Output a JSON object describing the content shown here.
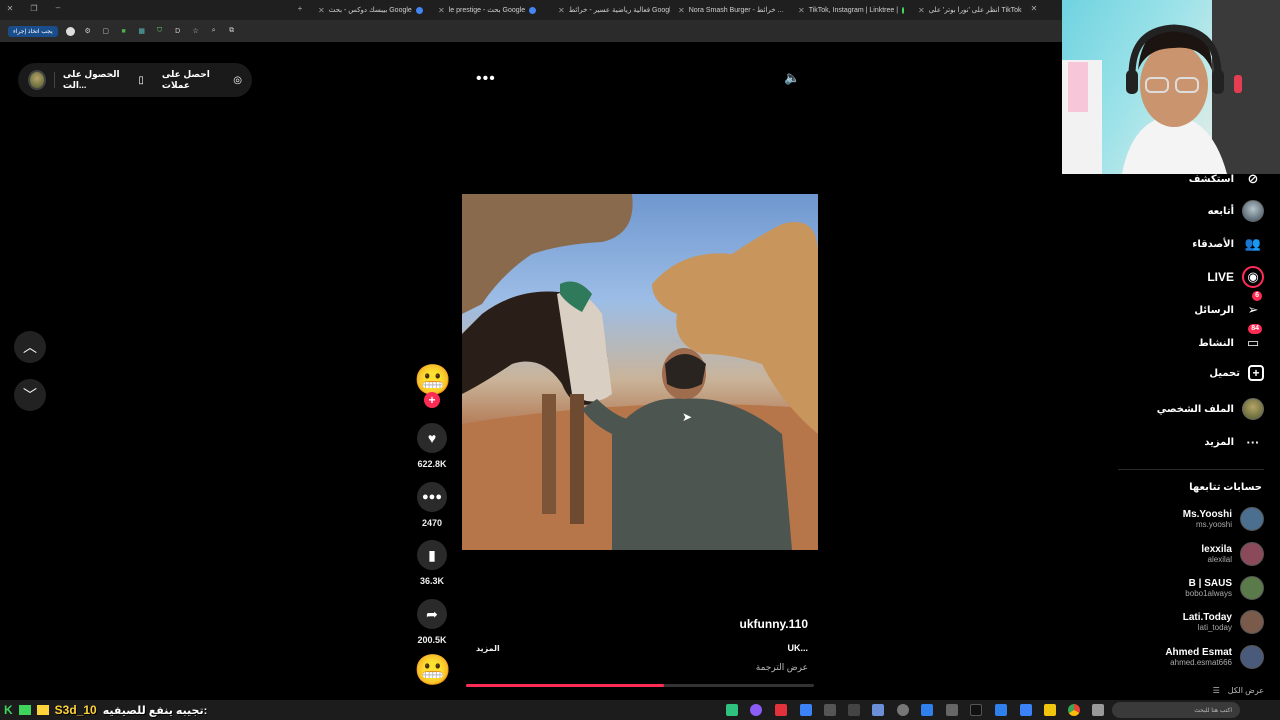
{
  "browser": {
    "tabs": [
      {
        "label": "بيبسك دوكس - بحث Google",
        "dot": "#4285f4"
      },
      {
        "label": "le prestige - بحث Google",
        "dot": "#4285f4"
      },
      {
        "label": "فعالية رياضية عسير - خرائط Google",
        "dot": "#34a853"
      },
      {
        "label": "Nora Smash Burger - خرائط ...",
        "dot": "#34a853"
      },
      {
        "label": "TikTok, Instagram | Linktree |",
        "dot": "#43e660"
      },
      {
        "label": "انظر على 'نورا بوتر' على TikTok",
        "dot": "#fe2c55"
      }
    ],
    "bookmark_pill": "يجب اتخاذ إجراء"
  },
  "top_chip": {
    "get_coins": "احصل على عملات",
    "get_app": "الحصول على الت..."
  },
  "video_actions": {
    "likes": "622.8K",
    "comments": "2470",
    "saves": "36.3K",
    "shares": "200.5K"
  },
  "caption": {
    "author": "ukfunny.110",
    "text": "UK...",
    "more": "المزيد",
    "translate": "عرض الترجمة",
    "progress": 0.57
  },
  "sidebar": {
    "explore": "استكشف",
    "following": "أتابعه",
    "friends": "الأصدقاء",
    "live": "LIVE",
    "messages": "الرسائل",
    "messages_badge": "6",
    "activity": "النشاط",
    "activity_badge": "84",
    "upload": "تحميل",
    "profile": "الملف الشخصي",
    "more": "المزيد"
  },
  "following_accounts": {
    "heading": "حسابات تتابعها",
    "accounts": [
      {
        "name": "Ms.Yooshi",
        "handle": "ms.yooshi",
        "color": "#4a6f8f"
      },
      {
        "name": "lexxila",
        "handle": "alexilal",
        "color": "#8a4a5a"
      },
      {
        "name": "B | SAUS",
        "handle": "bobo1always",
        "color": "#5a7a4a"
      },
      {
        "name": "Lati.Today",
        "handle": "lati_today",
        "color": "#7a5a4a"
      },
      {
        "name": "Ahmed Esmat",
        "handle": "ahmed.esmat666",
        "color": "#4a5a7a"
      }
    ],
    "see_all": "عرض الكل"
  },
  "stream_overlay": {
    "logo": "K",
    "code": "S3d_10",
    "message": "تجيبه ينفع للصيفيه:"
  },
  "taskbar": {
    "search_placeholder": "اكتب هنا للبحث"
  }
}
